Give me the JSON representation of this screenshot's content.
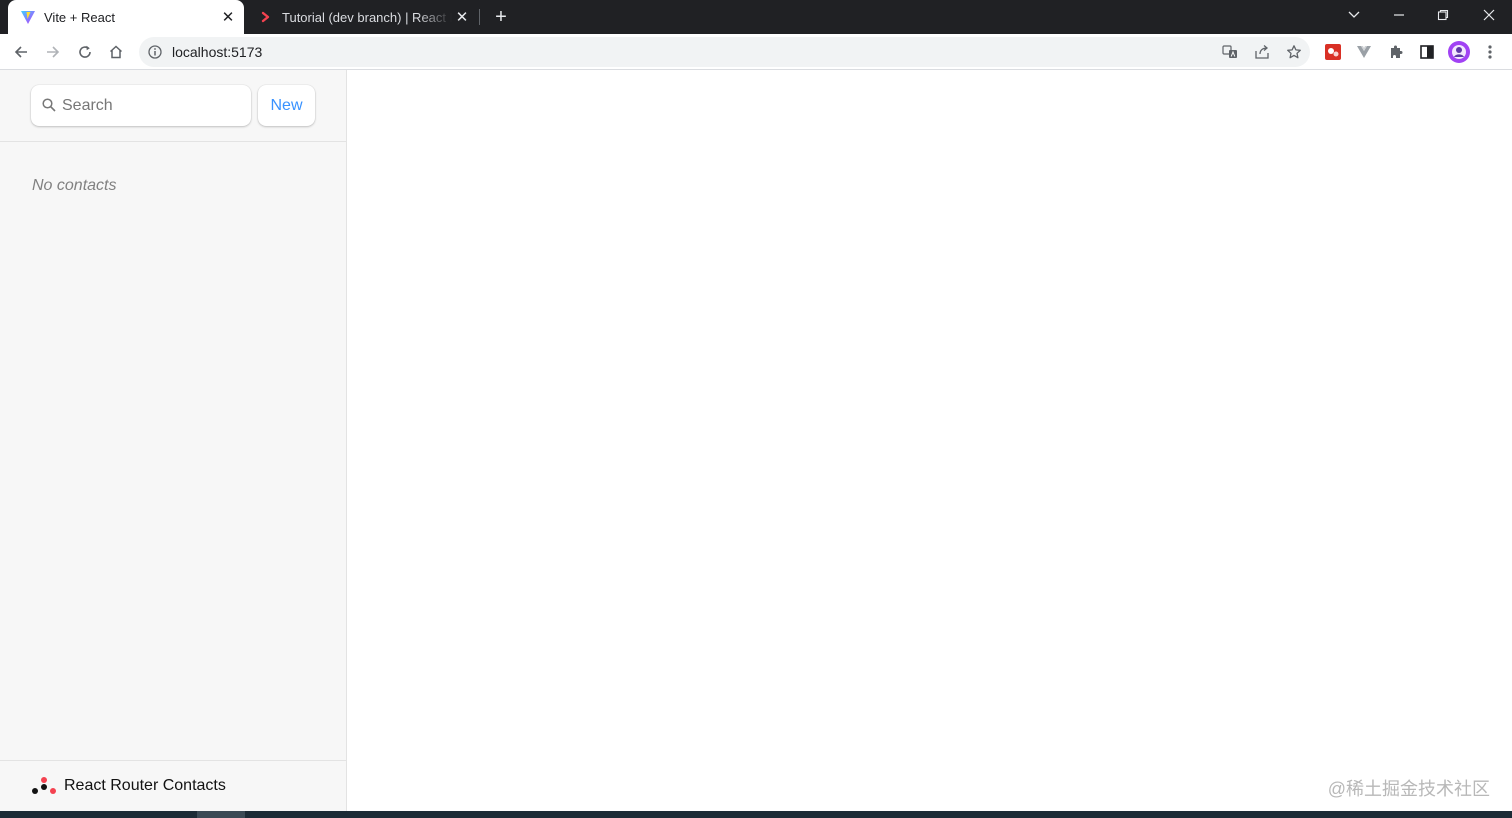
{
  "browser": {
    "tabs": [
      {
        "title": "Vite + React",
        "active": true,
        "favicon": "vite-icon"
      },
      {
        "title": "Tutorial (dev branch) | React Router",
        "active": false,
        "favicon": "react-router-icon"
      }
    ],
    "address": {
      "url": "localhost:5173"
    },
    "colors": {
      "tabstrip": "#202124",
      "omnibox": "#f1f3f4"
    }
  },
  "sidebar": {
    "search": {
      "placeholder": "Search",
      "value": ""
    },
    "new_label": "New",
    "empty_text": "No contacts",
    "brand": "React Router Contacts",
    "colors": {
      "accent": "#3992ff",
      "background": "#f7f7f7"
    }
  },
  "watermark": "@稀土掘金技术社区"
}
